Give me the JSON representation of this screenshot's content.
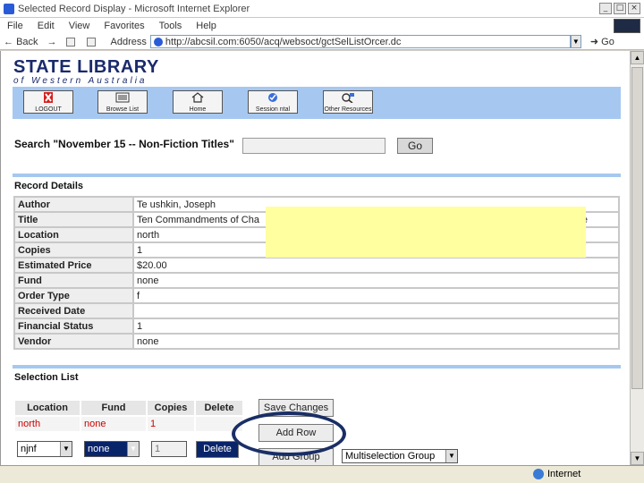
{
  "window": {
    "title": "Selected Record Display - Microsoft Internet Explorer",
    "buttons": [
      "_",
      "□",
      "×"
    ]
  },
  "menu": [
    "File",
    "Edit",
    "View",
    "Favorites",
    "Tools",
    "Help"
  ],
  "toolbar": {
    "back": "Back",
    "address_label": "Address",
    "url": "http://abcsil.com:6050/acq/websoct/gctSelListOrcer.dc",
    "go": "Go"
  },
  "logo": {
    "title_a": "STATE ",
    "title_b": "LIBRARY",
    "subtitle": "of Western Australia"
  },
  "nav": [
    {
      "label": "LOGOUT",
      "icon": "logout-x-icon"
    },
    {
      "label": "Browse List",
      "icon": "browse-list-icon"
    },
    {
      "label": "Home",
      "icon": "home-icon"
    },
    {
      "label": "Session    ntal",
      "icon": "session-check-icon"
    },
    {
      "label": "Other Resources",
      "icon": "other-resources-icon"
    }
  ],
  "search": {
    "label": "Search \"November 15 -- Non-Fiction Titles\"",
    "value": "",
    "button": "Go"
  },
  "record": {
    "title": "Record Details",
    "rows": [
      {
        "key": "Author",
        "value": "Te ushkin, Joseph"
      },
      {
        "key": "Title",
        "value": "Ten Commandments of Cha"
      },
      {
        "key": "Location",
        "value": "north"
      },
      {
        "key": "Copies",
        "value": "1"
      },
      {
        "key": "Estimated Price",
        "value": "$20.00"
      },
      {
        "key": "Fund",
        "value": "none"
      },
      {
        "key": "Order Type",
        "value": "f"
      },
      {
        "key": "Received Date",
        "value": ""
      },
      {
        "key": "Financial Status",
        "value": "1"
      },
      {
        "key": "Vendor",
        "value": "none"
      }
    ],
    "title_tail": "e"
  },
  "selection": {
    "title": "Selection List",
    "headers": [
      "Location",
      "Fund",
      "Copies",
      "Delete"
    ],
    "row": [
      "north",
      "none",
      "1",
      ""
    ],
    "edit": {
      "location": "njnf",
      "fund": "none",
      "copies": "1",
      "delete_btn": "Delete"
    },
    "buttons": {
      "save": "Save Changes",
      "add_row": "Add Row",
      "add_group": "Add Group"
    },
    "group_select": "Multiselection Group"
  },
  "status": {
    "zone": "Internet"
  },
  "colors": {
    "nav_band": "#a6c8f0",
    "highlight": "#ffffa0",
    "oval": "#1a2e66",
    "brand": "#1a2a6c"
  }
}
